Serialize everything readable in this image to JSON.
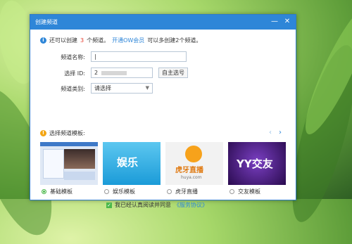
{
  "dialog": {
    "title": "创建频道",
    "info": {
      "pre": "还可以创建",
      "count": "3",
      "mid": "个频道。",
      "link": "开通OW会员",
      "post": "可以多创建2个频道。"
    },
    "form": {
      "name_label": "频道名称:",
      "name_value": "|",
      "id_label": "选择 ID:",
      "id_value": "2",
      "id_button": "自主选号",
      "type_label": "频道类别:",
      "type_value": "请选择"
    },
    "templates": {
      "label": "选择频道模板:",
      "items": [
        {
          "label": "基础模板",
          "selected": true,
          "thumb_text": ""
        },
        {
          "label": "娱乐模板",
          "selected": false,
          "thumb_text": "娱乐"
        },
        {
          "label": "虎牙直播",
          "selected": false,
          "thumb_text": "虎牙直播",
          "thumb_sub": "huya.com"
        },
        {
          "label": "交友模板",
          "selected": false,
          "thumb_text": "YY交友"
        }
      ]
    },
    "agreement": {
      "text": "我已经认真阅读并同意",
      "link": "《服务协议》"
    },
    "colors": {
      "accent": "#2e86d8",
      "red": "#e53b2c",
      "green": "#4bb84a"
    }
  }
}
